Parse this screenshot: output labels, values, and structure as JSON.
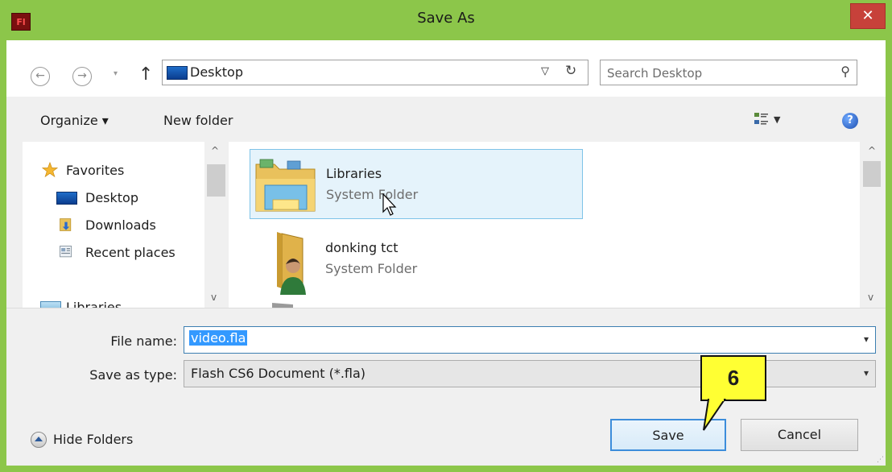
{
  "window": {
    "title": "Save As",
    "app_icon_text": "Fl",
    "close_symbol": "✕"
  },
  "address": {
    "path": "Desktop",
    "search_placeholder": "Search Desktop"
  },
  "toolbar": {
    "organize": "Organize ▾",
    "new_folder": "New folder"
  },
  "nav_pane": {
    "items": [
      {
        "label": "Favorites",
        "icon": "star-icon"
      },
      {
        "label": "Desktop",
        "icon": "desktop-icon"
      },
      {
        "label": "Downloads",
        "icon": "downloads-icon"
      },
      {
        "label": "Recent places",
        "icon": "recent-places-icon"
      },
      {
        "label": "Libraries",
        "icon": "libraries-icon"
      }
    ]
  },
  "files": [
    {
      "name": "Libraries",
      "type": "System Folder",
      "selected": true
    },
    {
      "name": "donking tct",
      "type": "System Folder",
      "selected": false
    }
  ],
  "form": {
    "file_name_label": "File name:",
    "file_name_value": "video.fla",
    "save_type_label": "Save as type:",
    "save_type_value": "Flash CS6 Document (*.fla)"
  },
  "footer": {
    "hide_folders": "Hide Folders",
    "save": "Save",
    "cancel": "Cancel"
  },
  "callout": {
    "number": "6",
    "color": "#ffff33"
  },
  "colors": {
    "frame": "#8cc64a",
    "close": "#c7413a",
    "selection": "#e5f3fb",
    "accent": "#3399ff"
  }
}
